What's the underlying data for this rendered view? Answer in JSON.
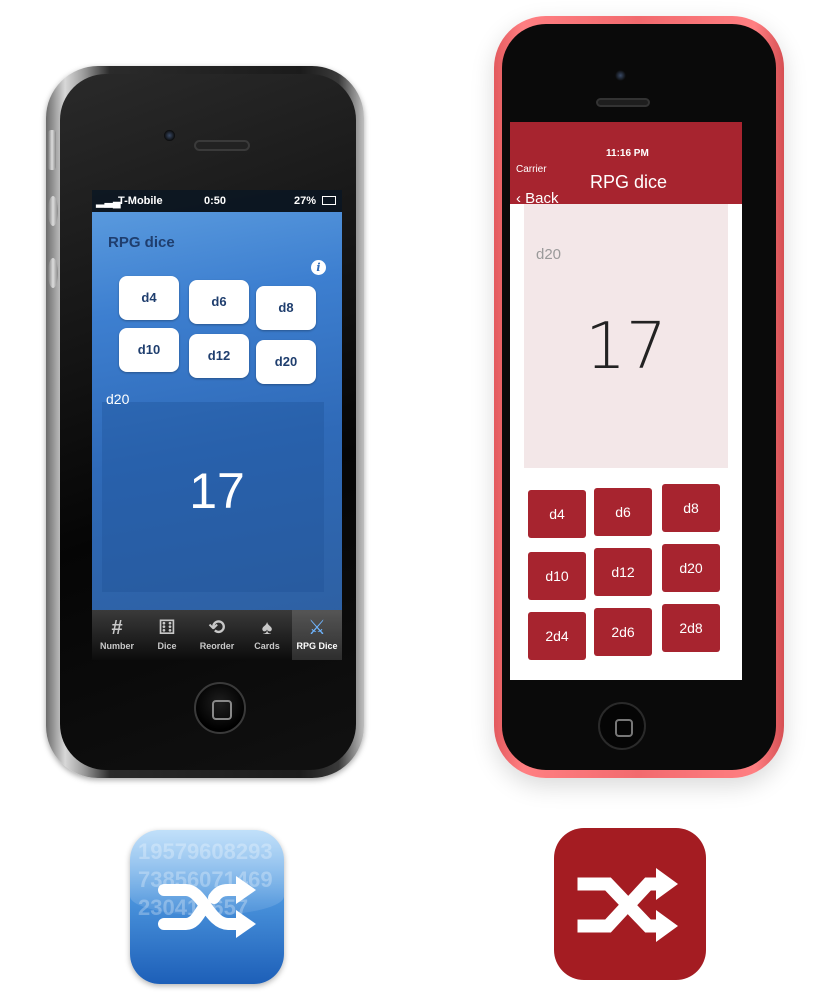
{
  "left_app": {
    "status": {
      "carrier": "T-Mobile",
      "time": "0:50",
      "battery": "27%"
    },
    "title": "RPG dice",
    "info_icon": "i",
    "dice": [
      "d4",
      "d6",
      "d8",
      "d10",
      "d12",
      "d20"
    ],
    "result_label": "d20",
    "result_value": "17",
    "tabs": [
      {
        "label": "Number",
        "icon": "#"
      },
      {
        "label": "Dice",
        "icon": "⚅"
      },
      {
        "label": "Reorder",
        "icon": "⟲"
      },
      {
        "label": "Cards",
        "icon": "♠"
      },
      {
        "label": "RPG Dice",
        "icon": "⚔"
      }
    ],
    "active_tab": "RPG Dice"
  },
  "right_app": {
    "status": {
      "carrier": "Carrier",
      "time": "11:16 PM"
    },
    "back_label": "‹ Back",
    "title": "RPG dice",
    "result_label": "d20",
    "result_value": "17",
    "dice": [
      "d4",
      "d6",
      "d8",
      "d10",
      "d12",
      "d20",
      "2d4",
      "2d6",
      "2d8"
    ],
    "accent_color": "#a7242f"
  },
  "icons": {
    "left_app_icon": "shuffle-icon",
    "left_app_icon_digits": "1957960829373856071469230412657",
    "right_app_icon": "shuffle-icon"
  }
}
